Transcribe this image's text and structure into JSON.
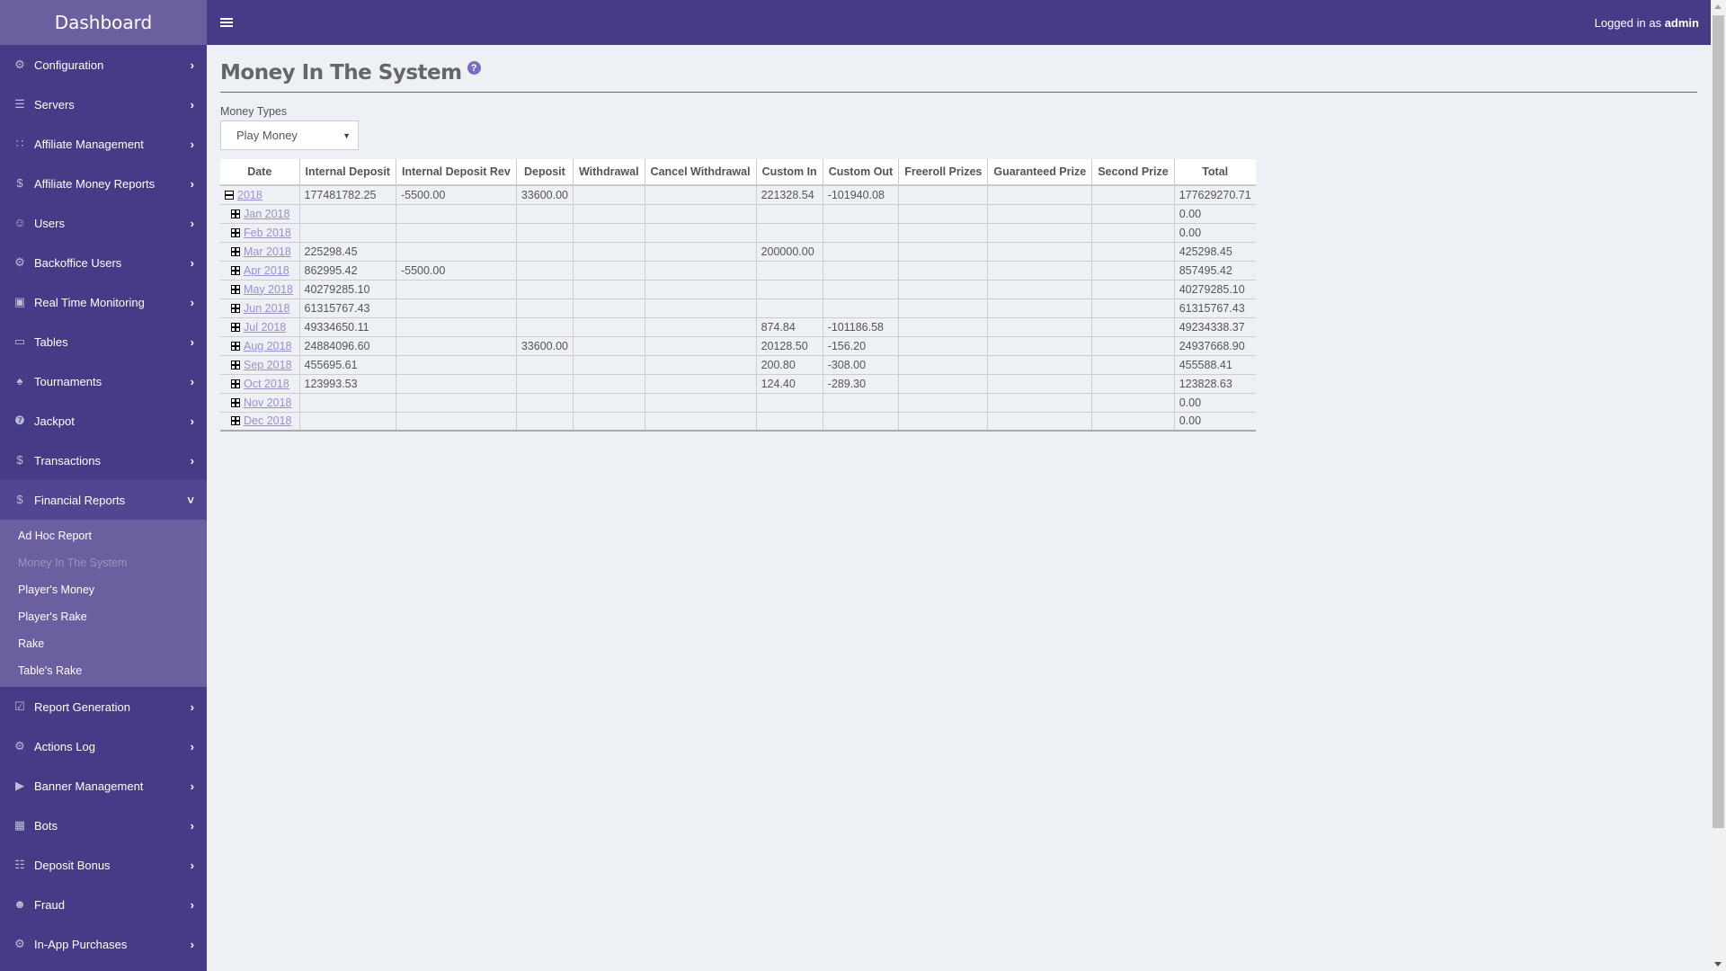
{
  "brand": "Dashboard",
  "header": {
    "login_prefix": "Logged in as",
    "username": "admin"
  },
  "sidebar": {
    "items": [
      {
        "label": "Configuration",
        "icon": "gear-icon"
      },
      {
        "label": "Servers",
        "icon": "server-icon"
      },
      {
        "label": "Affiliate Management",
        "icon": "affiliate-icon"
      },
      {
        "label": "Affiliate Money Reports",
        "icon": "money-report-icon"
      },
      {
        "label": "Users",
        "icon": "users-icon"
      },
      {
        "label": "Backoffice Users",
        "icon": "gear-icon"
      },
      {
        "label": "Real Time Monitoring",
        "icon": "monitor-icon"
      },
      {
        "label": "Tables",
        "icon": "tables-icon"
      },
      {
        "label": "Tournaments",
        "icon": "trophy-icon"
      },
      {
        "label": "Jackpot",
        "icon": "jackpot-icon"
      },
      {
        "label": "Transactions",
        "icon": "transactions-icon"
      },
      {
        "label": "Financial Reports",
        "icon": "financial-icon"
      },
      {
        "label": "Report Generation",
        "icon": "report-icon"
      },
      {
        "label": "Actions Log",
        "icon": "gear-icon"
      },
      {
        "label": "Banner Management",
        "icon": "megaphone-icon"
      },
      {
        "label": "Bots",
        "icon": "robot-icon"
      },
      {
        "label": "Deposit Bonus",
        "icon": "gift-icon"
      },
      {
        "label": "Fraud",
        "icon": "fraud-icon"
      },
      {
        "label": "In-App Purchases",
        "icon": "gear-icon"
      }
    ],
    "financial_sub": [
      {
        "label": "Ad Hoc Report"
      },
      {
        "label": "Money In The System"
      },
      {
        "label": "Player's Money"
      },
      {
        "label": "Player's Rake"
      },
      {
        "label": "Rake"
      },
      {
        "label": "Table's Rake"
      }
    ]
  },
  "page": {
    "title": "Money In The System",
    "help": "?",
    "money_types_label": "Money Types",
    "money_type_selected": "Play Money"
  },
  "table": {
    "columns": [
      "Date",
      "Internal Deposit",
      "Internal Deposit Rev",
      "Deposit",
      "Withdrawal",
      "Cancel Withdrawal",
      "Custom In",
      "Custom Out",
      "Freeroll Prizes",
      "Guaranteed Prize",
      "Second Prize",
      "Total"
    ],
    "rows": [
      {
        "date": "2018",
        "level": "year",
        "expanded": true,
        "cells": [
          "177481782.25",
          "-5500.00",
          "33600.00",
          "",
          "",
          "221328.54",
          "-101940.08",
          "",
          "",
          "",
          "177629270.71"
        ]
      },
      {
        "date": "Jan 2018",
        "level": "month",
        "cells": [
          "",
          "",
          "",
          "",
          "",
          "",
          "",
          "",
          "",
          "",
          "0.00"
        ]
      },
      {
        "date": "Feb 2018",
        "level": "month",
        "cells": [
          "",
          "",
          "",
          "",
          "",
          "",
          "",
          "",
          "",
          "",
          "0.00"
        ]
      },
      {
        "date": "Mar 2018",
        "level": "month",
        "cells": [
          "225298.45",
          "",
          "",
          "",
          "",
          "200000.00",
          "",
          "",
          "",
          "",
          "425298.45"
        ]
      },
      {
        "date": "Apr 2018",
        "level": "month",
        "cells": [
          "862995.42",
          "-5500.00",
          "",
          "",
          "",
          "",
          "",
          "",
          "",
          "",
          "857495.42"
        ]
      },
      {
        "date": "May 2018",
        "level": "month",
        "cells": [
          "40279285.10",
          "",
          "",
          "",
          "",
          "",
          "",
          "",
          "",
          "",
          "40279285.10"
        ]
      },
      {
        "date": "Jun 2018",
        "level": "month",
        "cells": [
          "61315767.43",
          "",
          "",
          "",
          "",
          "",
          "",
          "",
          "",
          "",
          "61315767.43"
        ]
      },
      {
        "date": "Jul 2018",
        "level": "month",
        "cells": [
          "49334650.11",
          "",
          "",
          "",
          "",
          "874.84",
          "-101186.58",
          "",
          "",
          "",
          "49234338.37"
        ]
      },
      {
        "date": "Aug 2018",
        "level": "month",
        "cells": [
          "24884096.60",
          "",
          "33600.00",
          "",
          "",
          "20128.50",
          "-156.20",
          "",
          "",
          "",
          "24937668.90"
        ]
      },
      {
        "date": "Sep 2018",
        "level": "month",
        "cells": [
          "455695.61",
          "",
          "",
          "",
          "",
          "200.80",
          "-308.00",
          "",
          "",
          "",
          "455588.41"
        ]
      },
      {
        "date": "Oct 2018",
        "level": "month",
        "cells": [
          "123993.53",
          "",
          "",
          "",
          "",
          "124.40",
          "-289.30",
          "",
          "",
          "",
          "123828.63"
        ]
      },
      {
        "date": "Nov 2018",
        "level": "month",
        "cells": [
          "",
          "",
          "",
          "",
          "",
          "",
          "",
          "",
          "",
          "",
          "0.00"
        ]
      },
      {
        "date": "Dec 2018",
        "level": "month",
        "cells": [
          "",
          "",
          "",
          "",
          "",
          "",
          "",
          "",
          "",
          "",
          "0.00"
        ]
      }
    ]
  },
  "colors": {
    "sidebar": "#473a87",
    "brand_bg": "#6b5f9f",
    "accent": "#7a6cc2",
    "link": "#9b8fcf"
  }
}
